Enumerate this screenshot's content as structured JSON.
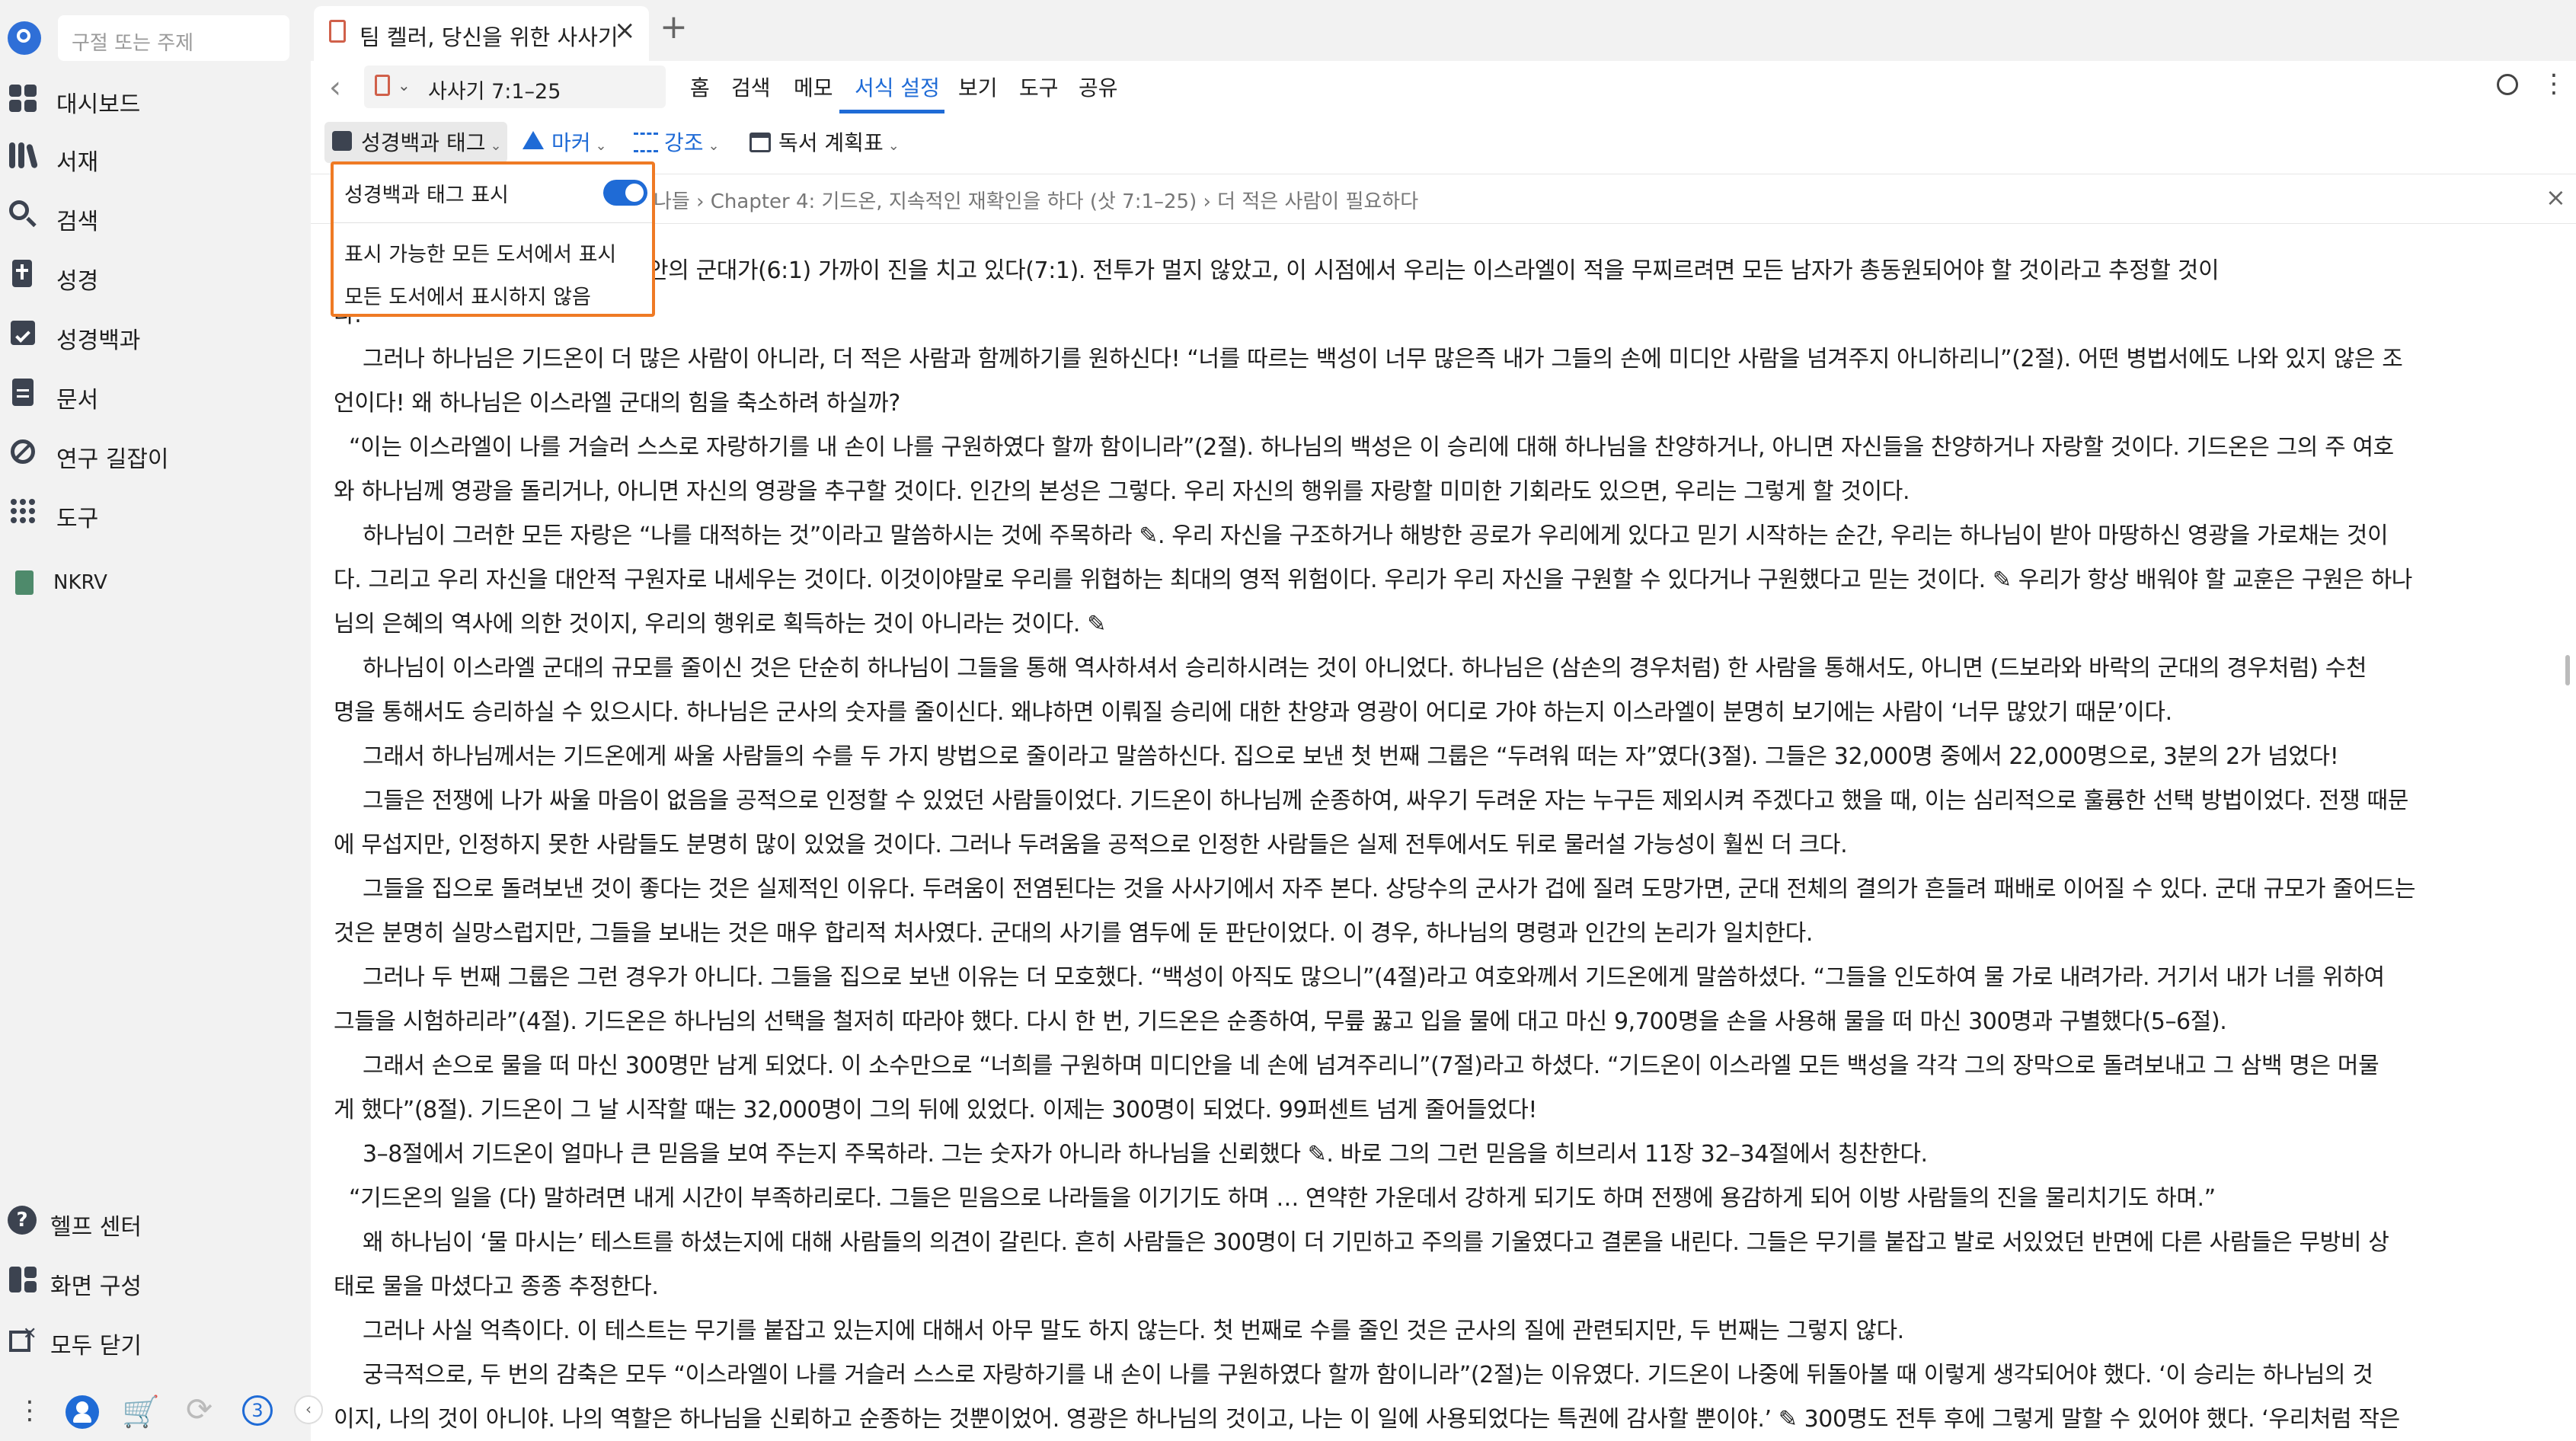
{
  "sidebar": {
    "search_placeholder": "구절 또는 주제",
    "items": [
      {
        "label": "대시보드",
        "icon": "dashboard-icon"
      },
      {
        "label": "서재",
        "icon": "library-icon"
      },
      {
        "label": "검색",
        "icon": "search-icon"
      },
      {
        "label": "성경",
        "icon": "bible-icon"
      },
      {
        "label": "성경백과",
        "icon": "encyclopedia-icon"
      },
      {
        "label": "문서",
        "icon": "document-icon"
      },
      {
        "label": "연구 길잡이",
        "icon": "guide-icon"
      },
      {
        "label": "도구",
        "icon": "tools-icon"
      },
      {
        "label": "NKRV",
        "icon": "book-icon"
      }
    ],
    "bottom": [
      {
        "label": "헬프 센터",
        "icon": "help-icon"
      },
      {
        "label": "화면 구성",
        "icon": "layout-icon"
      },
      {
        "label": "모두 닫기",
        "icon": "close-all-icon"
      }
    ],
    "badge": "3"
  },
  "tab": {
    "title": "팀 켈러, 당신을 위한 사사기"
  },
  "toolbar": {
    "reference": "사사기 7:1–25",
    "menus": [
      "홈",
      "검색",
      "메모",
      "서식 설정",
      "보기",
      "도구",
      "공유"
    ],
    "active_menu": "서식 설정"
  },
  "ribbon": {
    "tags_label": "성경백과 태그",
    "marker_label": "마커",
    "highlight_label": "강조",
    "reading_plan_label": "독서 계획표"
  },
  "dropdown": {
    "title": "성경백과 태그 표시",
    "toggle_on": true,
    "option1": "표시 가능한 모든 도서에서 표시",
    "option2": "모든 도서에서 표시하지 않음"
  },
  "breadcrumb": "나들 › Chapter 4: 기드온, 지속적인 재확인을 하다 (삿 7:1–25) › 더 적은 사람이 필요하다",
  "body_lines": [
    "7년 동안 압제해 온 미디안의 군대가(6:1) 가까이 진을 치고 있다(7:1). 전투가 멀지 않았고, 이 시점에서 우리는 이스라엘이 적을 무찌르려면 모든 남자가 총동원되어야 할 것이라고 추정할 것이",
    "다.",
    "그러나 하나님은 기드온이 더 많은 사람이 아니라, 더 적은 사람과 함께하기를 원하신다! “너를 따르는 백성이 너무 많은즉 내가 그들의 손에 미디안 사람을 넘겨주지 아니하리니”(2절). 어떤 병법서에도 나와 있지 않은 조",
    "언이다! 왜 하나님은 이스라엘 군대의 힘을 축소하려 하실까?",
    "“이는 이스라엘이 나를 거슬러 스스로 자랑하기를 내 손이 나를 구원하였다 할까 함이니라”(2절). 하나님의 백성은 이 승리에 대해 하나님을 찬양하거나, 아니면 자신들을 찬양하거나 자랑할 것이다. 기드온은 그의 주 여호",
    "와 하나님께 영광을 돌리거나, 아니면 자신의 영광을 추구할 것이다. 인간의 본성은 그렇다. 우리 자신의 행위를 자랑할 미미한 기회라도 있으면, 우리는 그렇게 할 것이다.",
    "하나님이 그러한 모든 자랑은 “나를 대적하는 것”이라고 말씀하시는 것에 주목하라 ✎. 우리 자신을 구조하거나 해방한 공로가 우리에게 있다고 믿기 시작하는 순간, 우리는 하나님이 받아 마땅하신 영광을 가로채는 것이",
    "다. 그리고 우리 자신을 대안적 구원자로 내세우는 것이다. 이것이야말로 우리를 위협하는 최대의 영적 위험이다. 우리가 우리 자신을 구원할 수 있다거나 구원했다고 믿는 것이다. ✎ 우리가 항상 배워야 할 교훈은 구원은 하나",
    "님의 은혜의 역사에 의한 것이지, 우리의 행위로 획득하는 것이 아니라는 것이다. ✎",
    "하나님이 이스라엘 군대의 규모를 줄이신 것은 단순히 하나님이 그들을 통해 역사하셔서 승리하시려는 것이 아니었다. 하나님은 (삼손의 경우처럼) 한 사람을 통해서도, 아니면 (드보라와 바락의 군대의 경우처럼) 수천",
    "명을 통해서도 승리하실 수 있으시다. 하나님은 군사의 숫자를 줄이신다. 왜냐하면 이뤄질 승리에 대한 찬양과 영광이 어디로 가야 하는지 이스라엘이 분명히 보기에는 사람이 ‘너무 많았기 때문’이다.",
    "그래서 하나님께서는 기드온에게 싸울 사람들의 수를 두 가지 방법으로 줄이라고 말씀하신다. 집으로 보낸 첫 번째 그룹은 “두려워 떠는 자”였다(3절). 그들은 32,000명 중에서 22,000명으로, 3분의 2가 넘었다!",
    "그들은 전쟁에 나가 싸울 마음이 없음을 공적으로 인정할 수 있었던 사람들이었다. 기드온이 하나님께 순종하여, 싸우기 두려운 자는 누구든 제외시켜 주겠다고 했을 때, 이는 심리적으로 훌륭한 선택 방법이었다. 전쟁 때문",
    "에 무섭지만, 인정하지 못한 사람들도 분명히 많이 있었을 것이다. 그러나 두려움을 공적으로 인정한 사람들은 실제 전투에서도 뒤로 물러설 가능성이 훨씬 더 크다.",
    "그들을 집으로 돌려보낸 것이 좋다는 것은 실제적인 이유다. 두려움이 전염된다는 것을 사사기에서 자주 본다. 상당수의 군사가 겁에 질려 도망가면, 군대 전체의 결의가 흔들려 패배로 이어질 수 있다. 군대 규모가 줄어드는",
    "것은 분명히 실망스럽지만, 그들을 보내는 것은 매우 합리적 처사였다. 군대의 사기를 염두에 둔 판단이었다. 이 경우, 하나님의 명령과 인간의 논리가 일치한다.",
    "그러나 두 번째 그룹은 그런 경우가 아니다. 그들을 집으로 보낸 이유는 더 모호했다. “백성이 아직도 많으니”(4절)라고 여호와께서 기드온에게 말씀하셨다. “그들을 인도하여 물 가로 내려가라. 거기서 내가 너를 위하여",
    "그들을 시험하리라”(4절). 기드온은 하나님의 선택을 철저히 따라야 했다. 다시 한 번, 기드온은 순종하여, 무릎 꿇고 입을 물에 대고 마신 9,700명을 손을 사용해 물을 떠 마신 300명과 구별했다(5–6절).",
    "그래서 손으로 물을 떠 마신 300명만 남게 되었다. 이 소수만으로 “너희를 구원하며 미디안을 네 손에 넘겨주리니”(7절)라고 하셨다. “기드온이 이스라엘 모든 백성을 각각 그의 장막으로 돌려보내고 그 삼백 명은 머물",
    "게 했다”(8절). 기드온이 그 날 시작할 때는 32,000명이 그의 뒤에 있었다. 이제는 300명이 되었다. 99퍼센트 넘게 줄어들었다!",
    "3–8절에서 기드온이 얼마나 큰 믿음을 보여 주는지 주목하라. 그는 숫자가 아니라 하나님을 신뢰했다 ✎. 바로 그의 그런 믿음을 히브리서 11장 32–34절에서 칭찬한다.",
    "“기드온의 일을 (다) 말하려면 내게 시간이 부족하리로다. 그들은 믿음으로 나라들을 이기기도 하며 … 연약한 가운데서 강하게 되기도 하며 전쟁에 용감하게 되어 이방 사람들의 진을 물리치기도 하며.”",
    "왜 하나님이 ‘물 마시는’ 테스트를 하셨는지에 대해 사람들의 의견이 갈린다. 흔히 사람들은 300명이 더 기민하고 주의를 기울였다고 결론을 내린다. 그들은 무기를 붙잡고 발로 서있었던 반면에 다른 사람들은 무방비 상",
    "태로 물을 마셨다고 종종 추정한다.",
    "그러나 사실 억측이다. 이 테스트는 무기를 붙잡고 있는지에 대해서 아무 말도 하지 않는다. 첫 번째로 수를 줄인 것은 군사의 질에 관련되지만, 두 번째는 그렇지 않다.",
    "궁극적으로, 두 번의 감축은 모두 “이스라엘이 나를 거슬러 스스로 자랑하기를 내 손이 나를 구원하였다 할까 함이니라”(2절)는 이유였다. 기드온이 나중에 뒤돌아볼 때 이렇게 생각되어야 했다. ‘이 승리는 하나님의 것",
    "이지, 나의 것이 아니야. 나의 역할은 하나님을 신뢰하고 순종하는 것뿐이었어. 영광은 하나님의 것이고, 나는 이 일에 사용되었다는 특권에 감사할 뿐이야.’ ✎ 300명도 전투 후에 그렇게 말할 수 있어야 했다. ‘우리처럼 작은"
  ]
}
